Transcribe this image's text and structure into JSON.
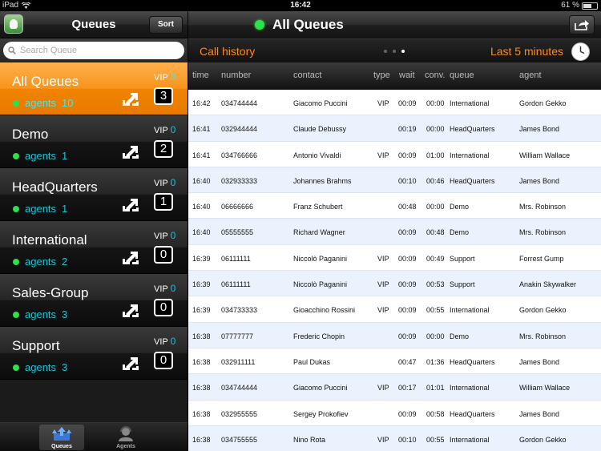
{
  "status_bar": {
    "device": "iPad",
    "time": "16:42",
    "battery_text": "61 %",
    "battery_level": 0.61
  },
  "left_panel": {
    "title": "Queues",
    "sort_label": "Sort",
    "search_placeholder": "Search Queue",
    "vip_label": "VIP",
    "agents_label": "agents",
    "queues": [
      {
        "name": "All Queues",
        "vip": "0",
        "agents": "10",
        "count": "3",
        "selected": true
      },
      {
        "name": "Demo",
        "vip": "0",
        "agents": "1",
        "count": "2",
        "selected": false
      },
      {
        "name": "HeadQuarters",
        "vip": "0",
        "agents": "1",
        "count": "1",
        "selected": false
      },
      {
        "name": "International",
        "vip": "0",
        "agents": "2",
        "count": "0",
        "selected": false
      },
      {
        "name": "Sales-Group",
        "vip": "0",
        "agents": "3",
        "count": "0",
        "selected": false
      },
      {
        "name": "Support",
        "vip": "0",
        "agents": "3",
        "count": "0",
        "selected": false
      }
    ],
    "tabs": [
      {
        "label": "Queues",
        "icon": "queues-icon",
        "active": true
      },
      {
        "label": "Agents",
        "icon": "agents-icon",
        "active": false
      }
    ]
  },
  "main": {
    "title": "All Queues",
    "call_history_label": "Call history",
    "time_range_label": "Last 5 minutes",
    "page_count": 3,
    "active_page": 3,
    "columns": [
      "time",
      "number",
      "contact",
      "type",
      "wait",
      "conv.",
      "queue",
      "agent"
    ],
    "rows": [
      {
        "time": "16:42",
        "number": "034744444",
        "contact": "Giacomo Puccini",
        "type": "VIP",
        "wait": "00:09",
        "conv": "00:00",
        "queue": "International",
        "agent": "Gordon Gekko"
      },
      {
        "time": "16:41",
        "number": "032944444",
        "contact": "Claude Debussy",
        "type": "",
        "wait": "00:19",
        "conv": "00:00",
        "queue": "HeadQuarters",
        "agent": "James Bond"
      },
      {
        "time": "16:41",
        "number": "034766666",
        "contact": "Antonio Vivaldi",
        "type": "VIP",
        "wait": "00:09",
        "conv": "01:00",
        "queue": "International",
        "agent": "William Wallace"
      },
      {
        "time": "16:40",
        "number": "032933333",
        "contact": "Johannes Brahms",
        "type": "",
        "wait": "00:10",
        "conv": "00:46",
        "queue": "HeadQuarters",
        "agent": "James Bond"
      },
      {
        "time": "16:40",
        "number": "06666666",
        "contact": "Franz Schubert",
        "type": "",
        "wait": "00:48",
        "conv": "00:00",
        "queue": "Demo",
        "agent": "Mrs. Robinson"
      },
      {
        "time": "16:40",
        "number": "05555555",
        "contact": "Richard Wagner",
        "type": "",
        "wait": "00:09",
        "conv": "00:48",
        "queue": "Demo",
        "agent": "Mrs. Robinson"
      },
      {
        "time": "16:39",
        "number": "06111111",
        "contact": "Niccolò Paganini",
        "type": "VIP",
        "wait": "00:09",
        "conv": "00:49",
        "queue": "Support",
        "agent": "Forrest Gump"
      },
      {
        "time": "16:39",
        "number": "06111111",
        "contact": "Niccolò Paganini",
        "type": "VIP",
        "wait": "00:09",
        "conv": "00:53",
        "queue": "Support",
        "agent": "Anakin Skywalker"
      },
      {
        "time": "16:39",
        "number": "034733333",
        "contact": "Gioacchino Rossini",
        "type": "VIP",
        "wait": "00:09",
        "conv": "00:55",
        "queue": "International",
        "agent": "Gordon Gekko"
      },
      {
        "time": "16:38",
        "number": "07777777",
        "contact": "Frederic Chopin",
        "type": "",
        "wait": "00:09",
        "conv": "00:00",
        "queue": "Demo",
        "agent": "Mrs. Robinson"
      },
      {
        "time": "16:38",
        "number": "032911111",
        "contact": "Paul Dukas",
        "type": "",
        "wait": "00:47",
        "conv": "01:36",
        "queue": "HeadQuarters",
        "agent": "James Bond"
      },
      {
        "time": "16:38",
        "number": "034744444",
        "contact": "Giacomo Puccini",
        "type": "VIP",
        "wait": "00:17",
        "conv": "01:01",
        "queue": "International",
        "agent": "William Wallace"
      },
      {
        "time": "16:38",
        "number": "032955555",
        "contact": "Sergey Prokofiev",
        "type": "",
        "wait": "00:09",
        "conv": "00:58",
        "queue": "HeadQuarters",
        "agent": "James Bond"
      },
      {
        "time": "16:38",
        "number": "034755555",
        "contact": "Nino Rota",
        "type": "VIP",
        "wait": "00:10",
        "conv": "00:55",
        "queue": "International",
        "agent": "Gordon Gekko"
      }
    ]
  },
  "colors": {
    "accent_orange": "#f08300",
    "status_green": "#2ee04a",
    "agents_cyan": "#19c6d8",
    "row_alt": "#eaf3fd"
  }
}
